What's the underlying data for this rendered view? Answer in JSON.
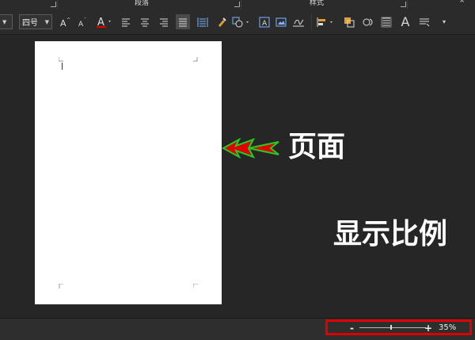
{
  "ribbon": {
    "groups": [
      {
        "label": "段落"
      },
      {
        "label": "样式"
      }
    ]
  },
  "toolbar": {
    "font_size_value": "四号"
  },
  "annotations": {
    "page_label": "页面",
    "zoom_label": "显示比例"
  },
  "status": {
    "zoom_percent": "35%",
    "zoom_minus": "-",
    "zoom_plus": "+"
  },
  "colors": {
    "annotation_box": "#e00000",
    "arrow_fill": "#e00000",
    "arrow_outline": "#22cc22",
    "font_color_underline": "#e00000"
  }
}
